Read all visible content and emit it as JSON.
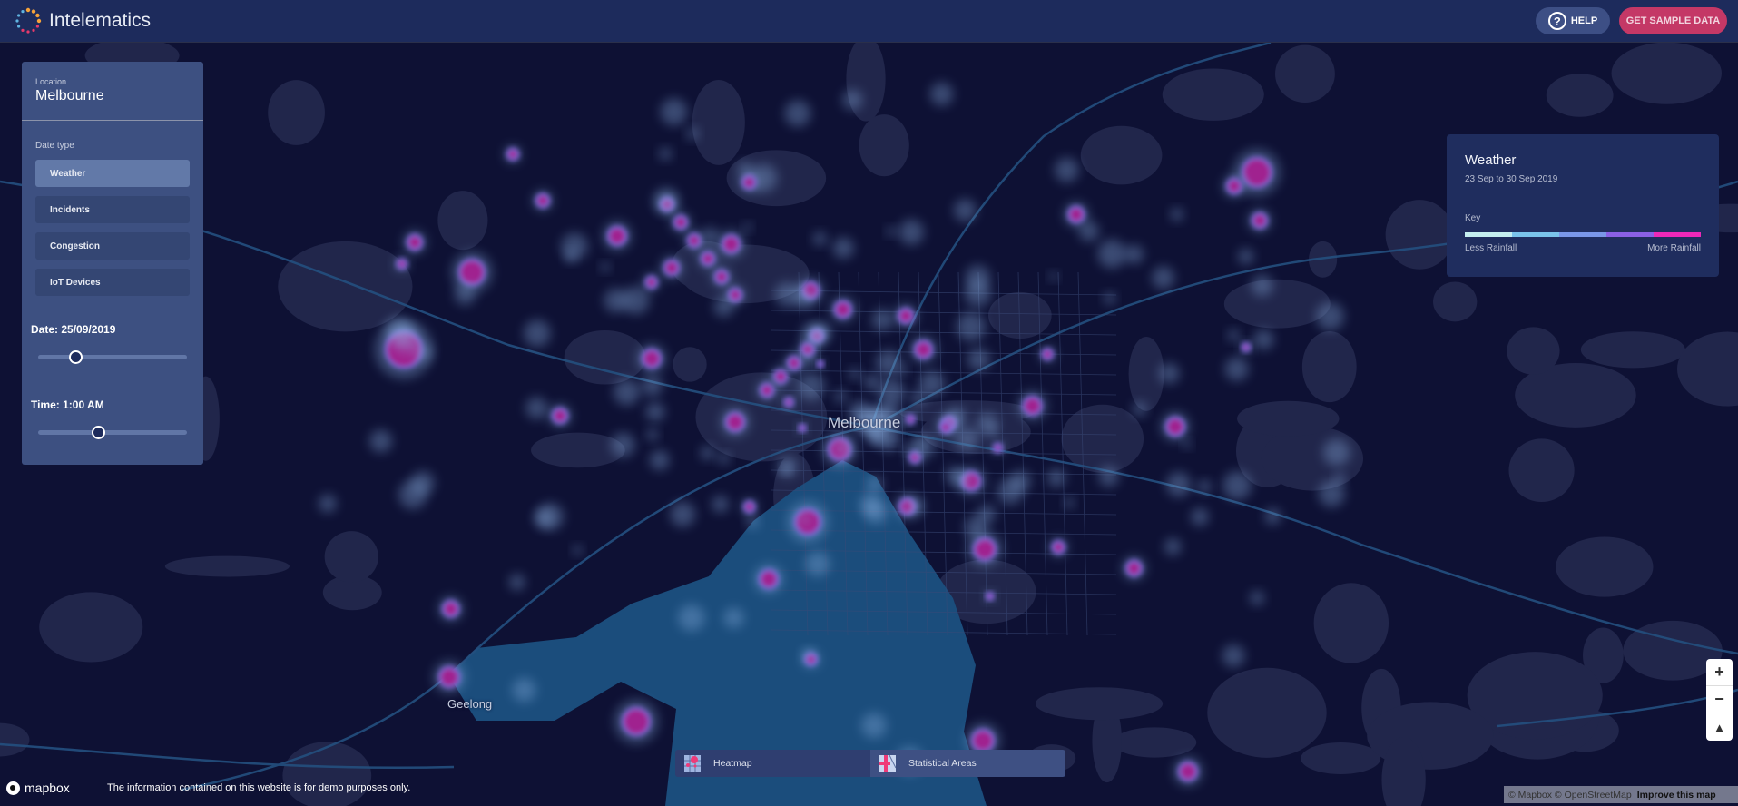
{
  "header": {
    "brand": "Intelematics",
    "help_label": "HELP",
    "sample_label": "GET SAMPLE DATA"
  },
  "panel": {
    "location_label": "Location",
    "location_value": "Melbourne",
    "date_type_label": "Date type",
    "date_types": [
      {
        "label": "Weather",
        "active": true
      },
      {
        "label": "Incidents",
        "active": false
      },
      {
        "label": "Congestion",
        "active": false
      },
      {
        "label": "IoT Devices",
        "active": false
      }
    ],
    "date_label": "Date: 25/09/2019",
    "date_slider_fraction": 0.25,
    "time_label": "Time: 1:00 AM",
    "time_slider_fraction": 0.4
  },
  "legend": {
    "title": "Weather",
    "range": "23 Sep to 30 Sep 2019",
    "key_label": "Key",
    "colors": [
      "#c4eef0",
      "#7ac3ea",
      "#7a97e8",
      "#8a60e6",
      "#ee28b8"
    ],
    "less": "Less Rainfall",
    "more": "More Rainfall"
  },
  "map": {
    "labels": {
      "melbourne": "Melbourne",
      "geelong": "Geelong"
    },
    "zoom_in": "+",
    "zoom_out": "−",
    "compass": "▲"
  },
  "layers": {
    "heatmap": "Heatmap",
    "statistical": "Statistical Areas"
  },
  "footer": {
    "mapbox": "mapbox",
    "disclaimer": "The information contained on this website is for demo purposes only.",
    "attribution": "© Mapbox © OpenStreetMap",
    "improve": "Improve this map"
  }
}
